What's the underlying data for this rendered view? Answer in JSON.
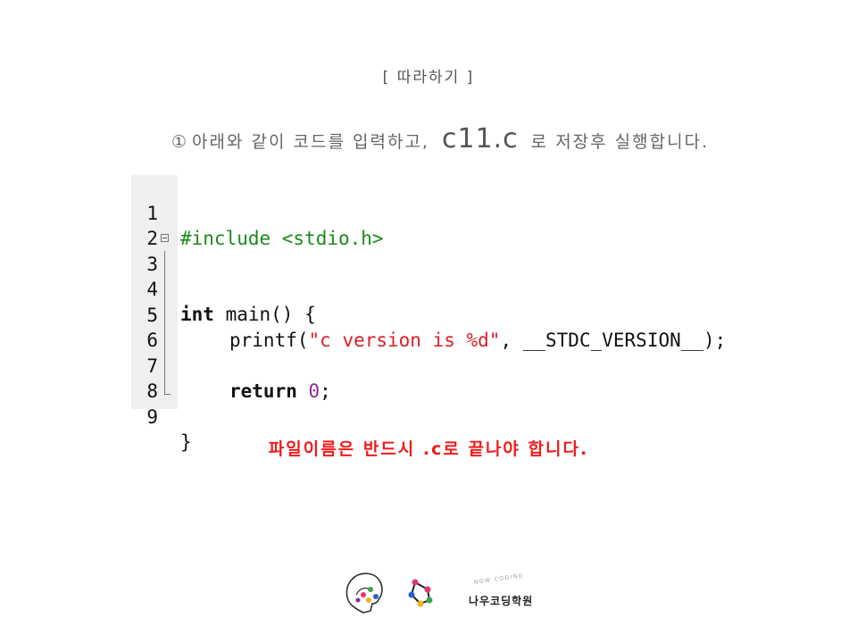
{
  "header": {
    "section_title": "[ 따라하기 ]"
  },
  "instruction": {
    "number": "①",
    "before": "아래와 같이 코드를 입력하고,",
    "filename": "c11.c",
    "after": "로 저장후 실행합니다."
  },
  "code": {
    "lines": [
      {
        "num": "1",
        "text": "#include <stdio.h>"
      },
      {
        "num": "2",
        "text": ""
      },
      {
        "num": "3",
        "text": "int main() {"
      },
      {
        "num": "4",
        "text": ""
      },
      {
        "num": "5",
        "text": "    printf(\"c version is %d\", __STDC_VERSION__);"
      },
      {
        "num": "6",
        "text": ""
      },
      {
        "num": "7",
        "text": "    return 0;"
      },
      {
        "num": "8",
        "text": ""
      },
      {
        "num": "9",
        "text": "}"
      }
    ],
    "tokens": {
      "include": "#include <stdio.h>",
      "int_kw": "int",
      "main_sig": " main() {",
      "printf_open": "printf(",
      "string_literal": "\"c version is %d\"",
      "printf_rest": ", __STDC_VERSION__);",
      "return_kw": "return",
      "zero": "0",
      "semicolon": ";",
      "close_brace": "}"
    },
    "colors": {
      "preprocessor": "#1a8a1a",
      "string": "#d9202a",
      "number": "#8a2a9a",
      "gutter_bg": "#efefef"
    }
  },
  "warning": {
    "text": "파일이름은 반드시 .c로 끝나야 합니다."
  },
  "logo": {
    "tagline": "NOW CODING",
    "brand": "나우코딩학원"
  }
}
